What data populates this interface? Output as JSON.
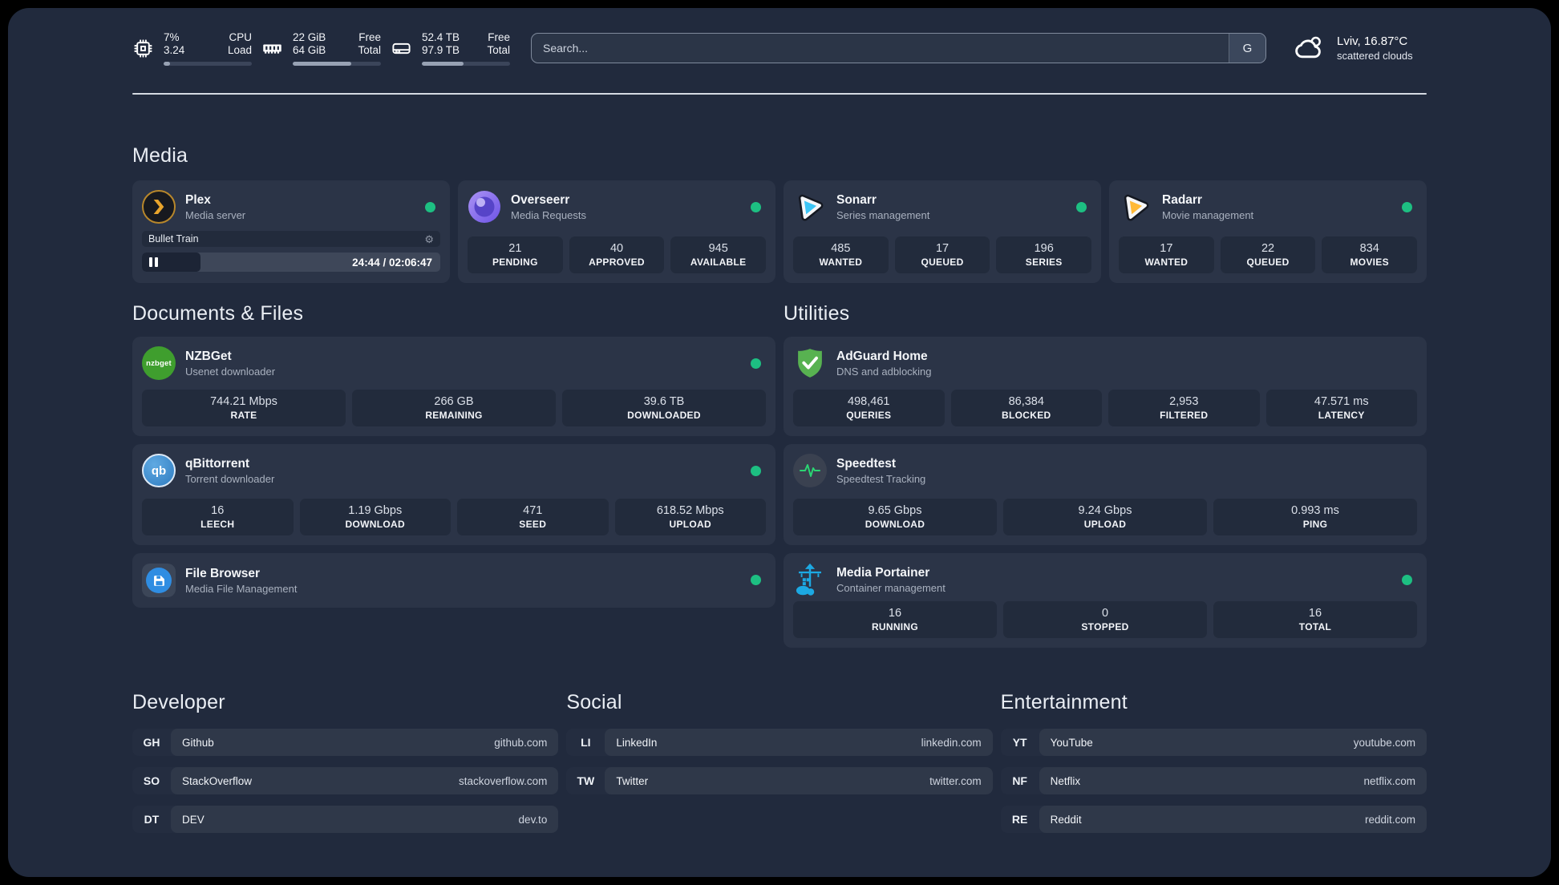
{
  "topbar": {
    "cpu": {
      "value_top": "7%",
      "value_bottom": "3.24",
      "label_top": "CPU",
      "label_bottom": "Load",
      "progress_pct": 7
    },
    "ram": {
      "value_top": "22 GiB",
      "value_bottom": "64 GiB",
      "label_top": "Free",
      "label_bottom": "Total",
      "progress_pct": 66
    },
    "disk": {
      "value_top": "52.4 TB",
      "value_bottom": "97.9 TB",
      "label_top": "Free",
      "label_bottom": "Total",
      "progress_pct": 47
    },
    "search": {
      "placeholder": "Search...",
      "engine_button": "G"
    },
    "weather": {
      "location_temp": "Lviv, 16.87°C",
      "condition": "scattered clouds"
    }
  },
  "sections": {
    "media": "Media",
    "documents": "Documents & Files",
    "utilities": "Utilities",
    "developer": "Developer",
    "social": "Social",
    "entertainment": "Entertainment"
  },
  "apps": {
    "plex": {
      "name": "Plex",
      "desc": "Media server",
      "status": "online",
      "now_playing": "Bullet Train",
      "time": "24:44 / 02:06:47",
      "progress_pct": 19.5
    },
    "overseerr": {
      "name": "Overseerr",
      "desc": "Media Requests",
      "status": "online",
      "stats": [
        {
          "value": "21",
          "label": "PENDING"
        },
        {
          "value": "40",
          "label": "APPROVED"
        },
        {
          "value": "945",
          "label": "AVAILABLE"
        }
      ]
    },
    "sonarr": {
      "name": "Sonarr",
      "desc": "Series management",
      "status": "online",
      "stats": [
        {
          "value": "485",
          "label": "WANTED"
        },
        {
          "value": "17",
          "label": "QUEUED"
        },
        {
          "value": "196",
          "label": "SERIES"
        }
      ]
    },
    "radarr": {
      "name": "Radarr",
      "desc": "Movie management",
      "status": "online",
      "stats": [
        {
          "value": "17",
          "label": "WANTED"
        },
        {
          "value": "22",
          "label": "QUEUED"
        },
        {
          "value": "834",
          "label": "MOVIES"
        }
      ]
    },
    "nzbget": {
      "name": "NZBGet",
      "desc": "Usenet downloader",
      "status": "online",
      "icon_text": "nzbget",
      "stats": [
        {
          "value": "744.21 Mbps",
          "label": "RATE"
        },
        {
          "value": "266 GB",
          "label": "REMAINING"
        },
        {
          "value": "39.6 TB",
          "label": "DOWNLOADED"
        }
      ]
    },
    "qbittorrent": {
      "name": "qBittorrent",
      "desc": "Torrent downloader",
      "status": "online",
      "icon_text": "qb",
      "stats": [
        {
          "value": "16",
          "label": "LEECH"
        },
        {
          "value": "1.19 Gbps",
          "label": "DOWNLOAD"
        },
        {
          "value": "471",
          "label": "SEED"
        },
        {
          "value": "618.52 Mbps",
          "label": "UPLOAD"
        }
      ]
    },
    "filebrowser": {
      "name": "File Browser",
      "desc": "Media File Management",
      "status": "online"
    },
    "adguard": {
      "name": "AdGuard Home",
      "desc": "DNS and adblocking",
      "stats": [
        {
          "value": "498,461",
          "label": "QUERIES"
        },
        {
          "value": "86,384",
          "label": "BLOCKED"
        },
        {
          "value": "2,953",
          "label": "FILTERED"
        },
        {
          "value": "47.571 ms",
          "label": "LATENCY"
        }
      ]
    },
    "speedtest": {
      "name": "Speedtest",
      "desc": "Speedtest Tracking",
      "stats": [
        {
          "value": "9.65 Gbps",
          "label": "DOWNLOAD"
        },
        {
          "value": "9.24 Gbps",
          "label": "UPLOAD"
        },
        {
          "value": "0.993 ms",
          "label": "PING"
        }
      ]
    },
    "portainer": {
      "name": "Media Portainer",
      "desc": "Container management",
      "status": "online",
      "stats": [
        {
          "value": "16",
          "label": "RUNNING"
        },
        {
          "value": "0",
          "label": "STOPPED"
        },
        {
          "value": "16",
          "label": "TOTAL"
        }
      ]
    }
  },
  "links": {
    "developer": [
      {
        "abbr": "GH",
        "name": "Github",
        "url": "github.com"
      },
      {
        "abbr": "SO",
        "name": "StackOverflow",
        "url": "stackoverflow.com"
      },
      {
        "abbr": "DT",
        "name": "DEV",
        "url": "dev.to"
      }
    ],
    "social": [
      {
        "abbr": "LI",
        "name": "LinkedIn",
        "url": "linkedin.com"
      },
      {
        "abbr": "TW",
        "name": "Twitter",
        "url": "twitter.com"
      }
    ],
    "entertainment": [
      {
        "abbr": "YT",
        "name": "YouTube",
        "url": "youtube.com"
      },
      {
        "abbr": "NF",
        "name": "Netflix",
        "url": "netflix.com"
      },
      {
        "abbr": "RE",
        "name": "Reddit",
        "url": "reddit.com"
      }
    ]
  },
  "colors": {
    "page_bg": "#212a3d",
    "card_bg": "#2b3447",
    "tile_bg": "#222b3c",
    "status_online": "#1dbf82",
    "plex_gold": "#e8a42c",
    "sonarr_blue": "#3cc5f5",
    "radarr_yellow": "#ffb937",
    "adguard_green": "#58b251",
    "portainer_blue": "#1ca9e3"
  }
}
